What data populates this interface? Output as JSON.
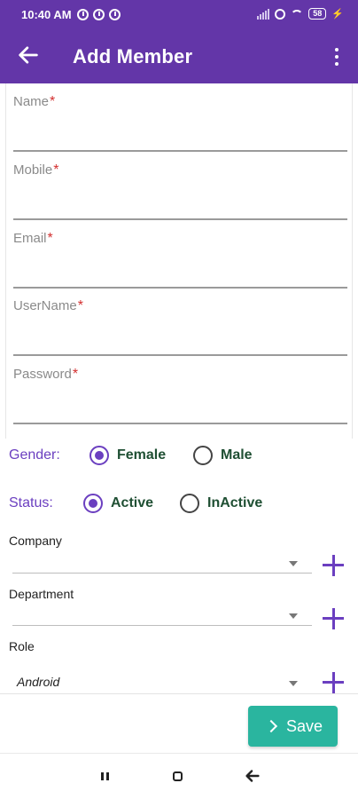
{
  "status_bar": {
    "time": "10:40 AM",
    "battery": "58"
  },
  "app_bar": {
    "title": "Add Member"
  },
  "form": {
    "fields": [
      {
        "label": "Name",
        "required": "*",
        "value": ""
      },
      {
        "label": "Mobile",
        "required": "*",
        "value": ""
      },
      {
        "label": "Email",
        "required": "*",
        "value": ""
      },
      {
        "label": "UserName",
        "required": "*",
        "value": ""
      },
      {
        "label": "Password",
        "required": "*",
        "value": ""
      }
    ],
    "gender": {
      "label": "Gender:",
      "options": [
        "Female",
        "Male"
      ],
      "selected": "Female"
    },
    "status": {
      "label": "Status:",
      "options": [
        "Active",
        "InActive"
      ],
      "selected": "Active"
    },
    "company": {
      "label": "Company",
      "value": ""
    },
    "department": {
      "label": "Department",
      "value": ""
    },
    "role": {
      "label": "Role",
      "value": "Android"
    }
  },
  "actions": {
    "save_label": "Save"
  },
  "colors": {
    "primary": "#6336a8",
    "accent": "#6b3fc0",
    "save_button": "#2ab59f",
    "required_mark": "#d32f2f",
    "option_text": "#1f4f33"
  },
  "icons": [
    "back-arrow-icon",
    "more-vert-icon",
    "radio-checked-icon",
    "radio-unchecked-icon",
    "dropdown-caret-icon",
    "plus-icon",
    "chevron-right-icon"
  ]
}
